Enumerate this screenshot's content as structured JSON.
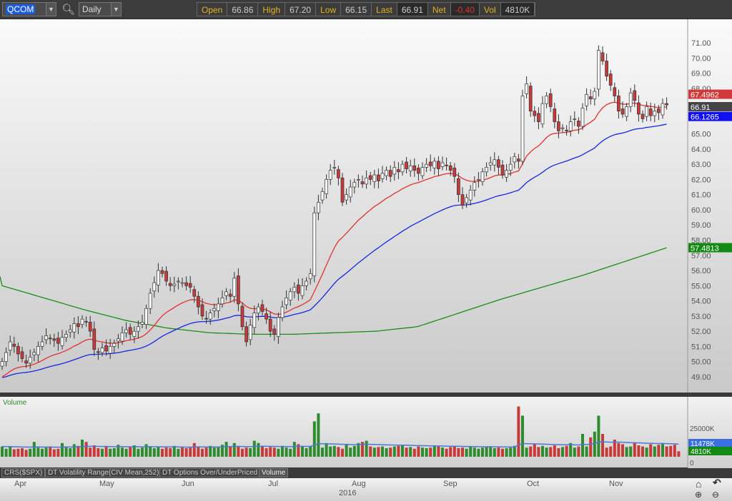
{
  "toolbar": {
    "symbol": "QCOM",
    "period": "Daily",
    "search_icon": "magnifier-icon",
    "quote": {
      "open_label": "Open",
      "open": "66.86",
      "high_label": "High",
      "high": "67.20",
      "low_label": "Low",
      "low": "66.15",
      "last_label": "Last",
      "last": "66.91",
      "net_label": "Net",
      "net": "-0.40",
      "vol_label": "Vol",
      "vol": "4810K"
    }
  },
  "price_axis": {
    "ticks": [
      "71.00",
      "70.00",
      "69.00",
      "68.00",
      "65.00",
      "64.00",
      "63.00",
      "62.00",
      "61.00",
      "60.00",
      "59.00",
      "58.00",
      "57.00",
      "56.00",
      "55.00",
      "54.00",
      "53.00",
      "52.00",
      "51.00",
      "50.00",
      "49.00"
    ],
    "badges": {
      "ma_red": "67.4962",
      "last": "66.91",
      "ma_blue": "66.1265",
      "ma_green": "57.4813"
    }
  },
  "volume_panel": {
    "title": "Volume",
    "ticks": [
      "25000K",
      "0"
    ],
    "badges": {
      "avg": "11478K",
      "last": "4810K"
    }
  },
  "indicator_tabs": [
    "CRS($SPX)",
    "DT Volatility Range(CIV Mean,252)",
    "DT Options Over/UnderPriced",
    "Volume"
  ],
  "time_axis": {
    "months": [
      "Apr",
      "May",
      "Jun",
      "Jul",
      "Aug",
      "Sep",
      "Oct",
      "Nov"
    ],
    "year": "2016"
  },
  "nav_icons": [
    "home-icon",
    "undo-icon",
    "zoom-in-icon",
    "zoom-out-icon"
  ],
  "colors": {
    "up": "#2e8b2e",
    "down": "#c83a3a",
    "ma_red": "#e03030",
    "ma_blue": "#1428e0",
    "ma_green": "#1a8c1a",
    "volume_avg": "#4a78d8"
  },
  "chart_data": {
    "type": "candlestick",
    "ylim": [
      48.5,
      72
    ],
    "closes": [
      50.0,
      50.6,
      51.3,
      51.0,
      50.5,
      50.2,
      49.9,
      50.3,
      50.6,
      51.0,
      51.3,
      51.7,
      51.5,
      51.4,
      51.2,
      51.6,
      51.8,
      52.1,
      52.5,
      52.3,
      52.8,
      52.6,
      52.0,
      50.8,
      50.6,
      50.9,
      50.7,
      51.0,
      51.2,
      51.5,
      51.9,
      52.1,
      51.8,
      52.0,
      52.3,
      52.6,
      53.5,
      54.5,
      55.2,
      56.0,
      55.8,
      55.3,
      55.0,
      55.1,
      55.3,
      55.2,
      55.0,
      54.9,
      54.3,
      53.6,
      53.0,
      52.8,
      53.2,
      53.5,
      53.8,
      54.2,
      54.6,
      54.3,
      55.5,
      53.8,
      52.3,
      51.3,
      52.4,
      53.2,
      53.6,
      53.3,
      52.8,
      52.0,
      51.8,
      52.9,
      53.6,
      54.2,
      54.6,
      54.9,
      54.5,
      55.0,
      55.3,
      55.8,
      59.8,
      60.5,
      61.2,
      62.0,
      62.6,
      62.8,
      62.1,
      60.5,
      61.0,
      61.5,
      61.8,
      62.0,
      61.7,
      62.1,
      62.0,
      62.3,
      61.9,
      62.4,
      62.6,
      62.2,
      62.8,
      62.5,
      63.0,
      62.7,
      62.9,
      62.6,
      62.4,
      62.8,
      63.0,
      62.9,
      63.2,
      62.7,
      63.1,
      62.9,
      62.6,
      62.2,
      61.0,
      60.3,
      60.8,
      61.3,
      61.8,
      62.0,
      62.5,
      62.8,
      63.1,
      63.3,
      62.8,
      62.3,
      62.6,
      63.0,
      63.5,
      63.2,
      67.5,
      68.3,
      66.5,
      66.2,
      65.8,
      67.0,
      67.5,
      66.8,
      65.8,
      65.2,
      65.4,
      65.2,
      65.8,
      66.0,
      65.5,
      66.7,
      67.6,
      67.3,
      67.8,
      70.5,
      69.8,
      68.8,
      68.2,
      67.5,
      66.5,
      66.3,
      66.8,
      67.7,
      67.2,
      66.3,
      66.0,
      66.8,
      66.2,
      66.5,
      66.4,
      67.0,
      66.91
    ],
    "volumes_k": [
      9000,
      7000,
      8500,
      6500,
      7000,
      7500,
      6000,
      7000,
      13000,
      8000,
      7000,
      8000,
      9000,
      6500,
      7000,
      12000,
      9000,
      7500,
      11000,
      9500,
      15000,
      13000,
      8000,
      10000,
      7500,
      7000,
      9500,
      7000,
      7500,
      10500,
      8000,
      7000,
      8500,
      10000,
      7000,
      8000,
      11000,
      9000,
      7500,
      9000,
      7000,
      8000,
      7500,
      9500,
      7000,
      8000,
      7500,
      8000,
      12000,
      9000,
      7000,
      8000,
      9500,
      8000,
      8500,
      10500,
      13000,
      9000,
      12000,
      9500,
      7000,
      8000,
      7500,
      14000,
      12000,
      9000,
      7500,
      8500,
      8000,
      7000,
      9500,
      8000,
      7000,
      13000,
      11000,
      9000,
      7500,
      9000,
      10000,
      7000,
      8000,
      12000,
      9000,
      9500,
      8500,
      7000,
      11000,
      8000,
      9500,
      12000,
      13000,
      14000,
      9000,
      8000,
      8500,
      9000,
      7500,
      8000,
      9000,
      9500,
      10000,
      8000,
      8500,
      7000,
      9000,
      8000,
      7500,
      8000,
      9500,
      9000,
      8000,
      7000,
      8500,
      9000,
      7500,
      8000,
      7000,
      9000,
      8000,
      7000,
      8000,
      8500,
      9000,
      7500,
      8000,
      7000,
      7500,
      8000,
      9500,
      10000,
      11000,
      8000,
      9000,
      11000,
      8500,
      9500,
      8000,
      8500,
      10000,
      7500,
      8500,
      9500,
      12000,
      8000,
      9000,
      13000,
      9000,
      17000,
      22000,
      8500,
      11000,
      8000,
      9000,
      15000,
      12000,
      11000,
      8500,
      9000,
      12000,
      10000,
      9000,
      8000,
      11000,
      9000,
      10500,
      12000,
      9000,
      9500,
      10500,
      4810
    ],
    "volume_spikes_k": {
      "78": 31000,
      "79": 38000,
      "129": 44000,
      "130": 36000,
      "145": 20000,
      "149": 36000,
      "150": 20000
    },
    "ma_green": [
      55.0,
      54.2,
      53.4,
      52.7,
      52.2,
      51.9,
      51.8,
      51.8,
      51.9,
      52.0,
      52.3,
      53.2,
      54.1,
      54.9,
      55.7,
      56.6,
      57.5
    ]
  }
}
